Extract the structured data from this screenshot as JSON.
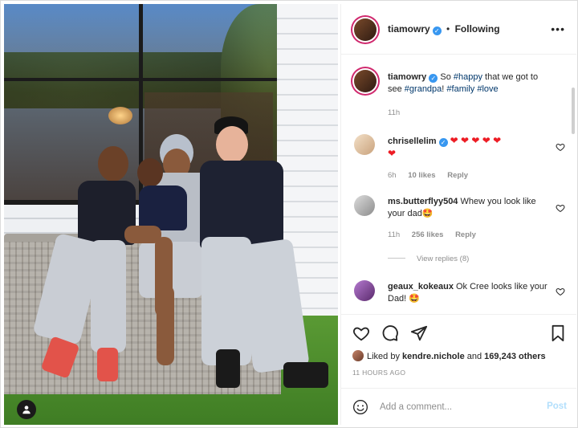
{
  "post": {
    "author": "tiamowry",
    "follow_separator": "•",
    "follow_status": "Following",
    "more_glyph": "•••"
  },
  "caption": {
    "username": "tiamowry",
    "text_before": "So ",
    "tag_happy": "#happy",
    "text_middle": " that we got to see ",
    "tag_grandpa": "#grandpa",
    "text_after": "! ",
    "tag_family": "#family",
    "tag_love": "#love",
    "age": "11h"
  },
  "comments": [
    {
      "username": "chrisellelim",
      "text": "",
      "hearts": "❤ ❤ ❤ ❤ ❤",
      "hearts_line2": "❤",
      "age": "6h",
      "likes": "10 likes",
      "reply": "Reply",
      "verified": true
    },
    {
      "username": "ms.butterflyy504",
      "text": "Whew you look like your dad",
      "emoji": "🤩",
      "age": "11h",
      "likes": "256 likes",
      "reply": "Reply",
      "view_replies": "View replies (8)"
    },
    {
      "username": "geaux_kokeaux",
      "text": "Ok Cree looks like your Dad!",
      "emoji": "🤩"
    }
  ],
  "engagement": {
    "liked_by_prefix": "Liked by",
    "liked_by_user": "kendre.nichole",
    "and": "and",
    "others": "169,243 others",
    "time_ago": "11 HOURS AGO"
  },
  "composer": {
    "placeholder": "Add a comment...",
    "post_label": "Post"
  },
  "colors": {
    "verified": "#3897f0",
    "hashtag": "#00376b",
    "story_ring": "#d0296e",
    "post_disabled": "#b2dffc"
  },
  "icons": [
    "user-tag-icon",
    "more-options-icon",
    "verified-icon",
    "heart-icon",
    "comment-icon",
    "share-icon",
    "bookmark-icon",
    "emoji-icon"
  ]
}
